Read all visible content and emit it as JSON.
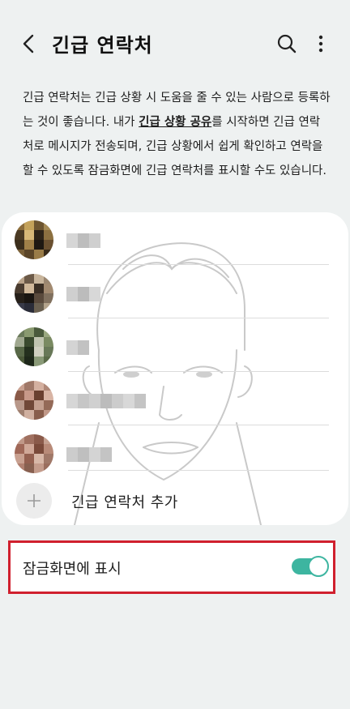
{
  "header": {
    "title": "긴급 연락처",
    "back_icon": "chevron-left-icon",
    "search_icon": "search-icon",
    "more_icon": "more-vertical-icon"
  },
  "description": {
    "part1": "긴급 연락처는 긴급 상황 시 도움을 줄 수 있는 사람으로 등록하는 것이 좋습니다. 내가 ",
    "link": "긴급 상황 공유",
    "part2": "를 시작하면 긴급 연락처로 메시지가 전송되며, 긴급 상황에서 쉽게 확인하고 연락을 할 수 있도록 잠금화면에 긴급 연락처를 표시할 수도 있습니다."
  },
  "contacts": {
    "count": 5,
    "add_label": "긴급 연락처 추가",
    "add_icon": "plus-icon"
  },
  "lock_screen": {
    "label": "잠금화면에 표시",
    "enabled": true
  },
  "colors": {
    "accent": "#3db5a0",
    "highlight": "#d0202e",
    "background": "#eef1f1"
  }
}
